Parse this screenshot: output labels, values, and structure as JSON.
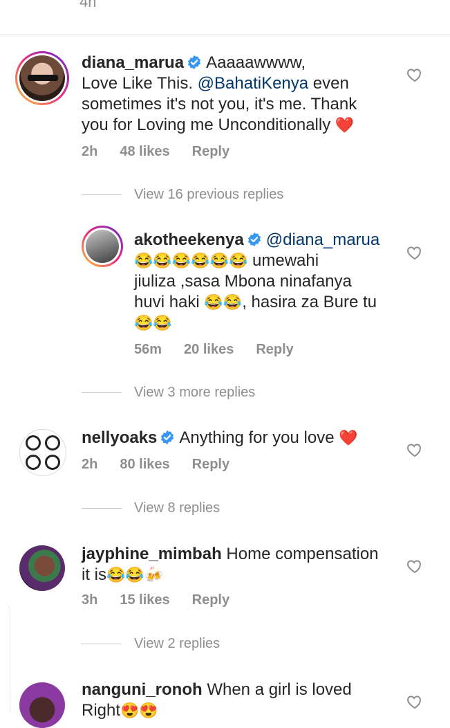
{
  "top_fragment": "4h",
  "comments": [
    {
      "username": "diana_marua",
      "text_1": "Aaaaawwww,",
      "text_2": "Love Like This.",
      "mention": "@BahatiKenya",
      "text_3": "even",
      "text_4": "sometimes it's not you, it's me. Thank",
      "text_5": "you for Loving me Unconditionally",
      "emoji": "❤️",
      "time": "2h",
      "likes": "48 likes",
      "reply": "Reply"
    },
    {
      "view_label": "View 16 previous replies"
    },
    {
      "username": "akotheekenya",
      "mention": "@diana_marua",
      "emojis_1": "😂😂😂😂😂😂",
      "text_1": "umewahi",
      "text_2": "jiuliza ,sasa Mbona ninafanya",
      "text_3": "huvi haki",
      "emojis_2": "😂😂",
      "text_4": ", hasira za Bure tu",
      "emojis_3": "😂😂",
      "time": "56m",
      "likes": "20 likes",
      "reply": "Reply"
    },
    {
      "view_label": "View 3 more replies"
    },
    {
      "username": "nellyoaks",
      "text_1": "Anything for you love",
      "emoji": "❤️",
      "time": "2h",
      "likes": "80 likes",
      "reply": "Reply"
    },
    {
      "view_label": "View 8 replies"
    },
    {
      "username": "jayphine_mimbah",
      "text_1": "Home compensation",
      "text_2": "it is",
      "emojis": "😂😂🍻",
      "time": "3h",
      "likes": "15 likes",
      "reply": "Reply"
    },
    {
      "view_label": "View 2 replies"
    },
    {
      "username": "nanguni_ronoh",
      "text_1": "When a girl is loved",
      "text_2": "Right",
      "emojis": "😍😍"
    }
  ],
  "colors": {
    "text": "#262626",
    "muted": "#8e8e8e",
    "mention": "#00376b",
    "verified": "#3897f0",
    "heart_red": "#ed4956"
  }
}
